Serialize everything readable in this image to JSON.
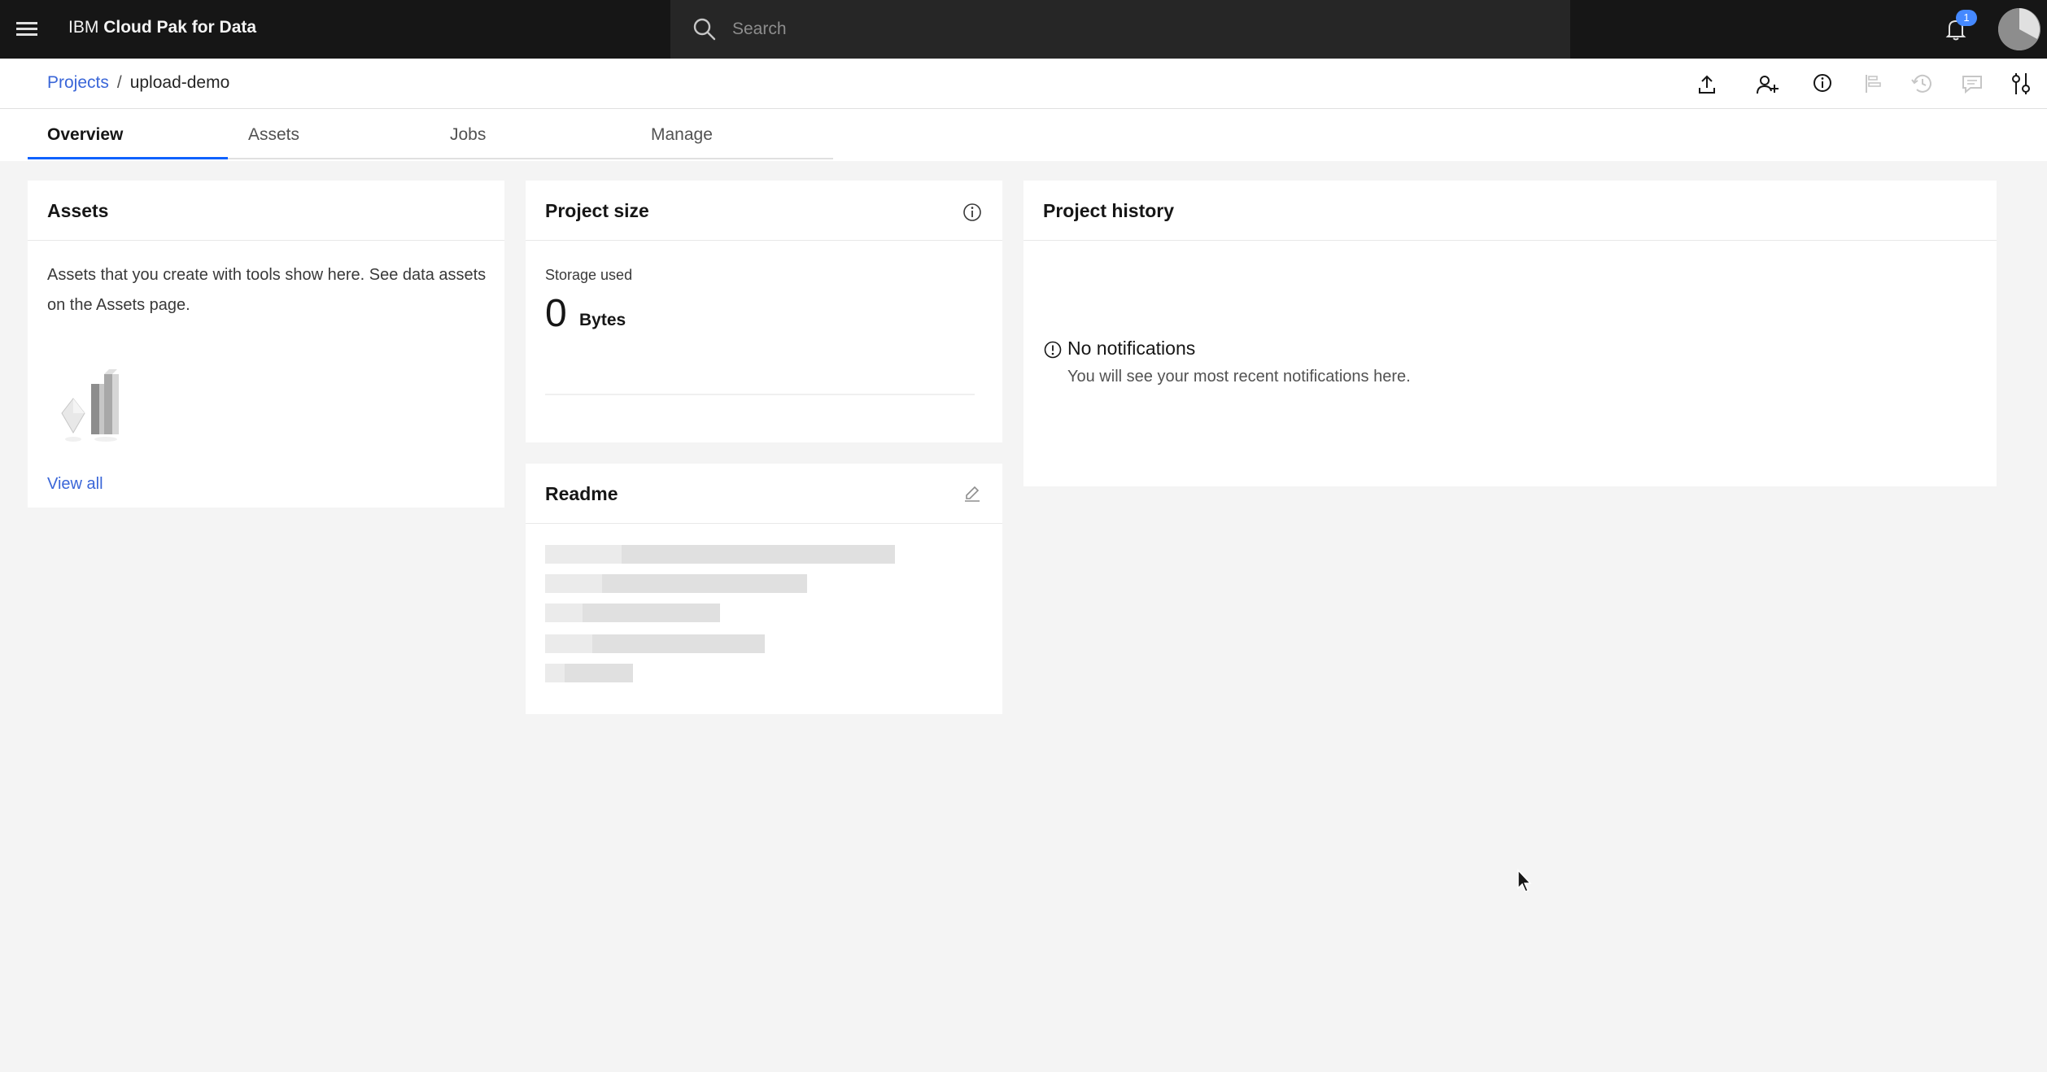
{
  "header": {
    "brand_prefix": "IBM",
    "brand_name": "Cloud Pak for Data",
    "search_placeholder": "Search",
    "notification_count": "1"
  },
  "breadcrumb": {
    "parent": "Projects",
    "separator": "/",
    "current": "upload-demo"
  },
  "toolbar": {
    "icons": [
      "upload-icon",
      "add-collaborator-icon",
      "info-icon",
      "flow-icon",
      "history-icon",
      "comment-icon",
      "settings-icon"
    ]
  },
  "tabs": [
    {
      "label": "Overview",
      "active": true
    },
    {
      "label": "Assets",
      "active": false
    },
    {
      "label": "Jobs",
      "active": false
    },
    {
      "label": "Manage",
      "active": false
    }
  ],
  "assets_tile": {
    "title": "Assets",
    "description": "Assets that you create with tools show here. See data assets on the Assets page.",
    "link": "View all"
  },
  "project_size_tile": {
    "title": "Project size",
    "storage_label": "Storage used",
    "storage_value": "0",
    "storage_unit": "Bytes"
  },
  "readme_tile": {
    "title": "Readme"
  },
  "history_tile": {
    "title": "Project history",
    "empty_title": "No notifications",
    "empty_body": "You will see your most recent notifications here."
  },
  "colors": {
    "header_bg": "#161616",
    "link": "#3a66d8",
    "accent": "#0f62fe",
    "page_bg": "#f4f4f4"
  }
}
